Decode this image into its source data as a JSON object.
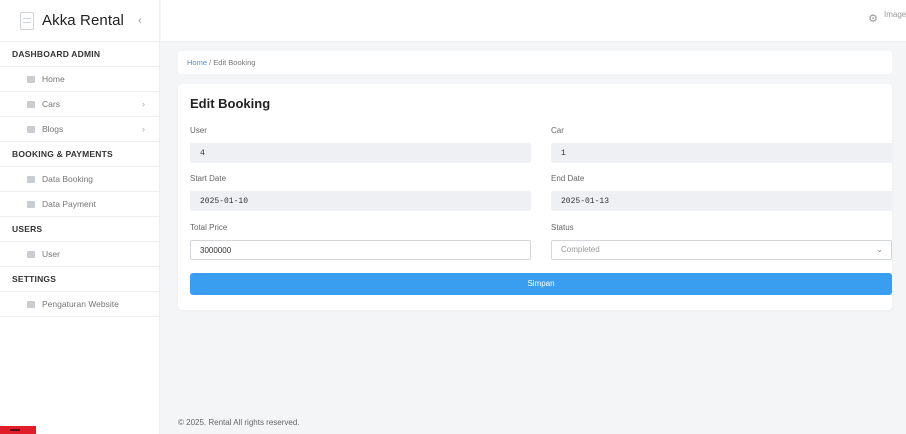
{
  "sidebar": {
    "brand": "Akka Rental",
    "toggle_icon": "chevron-left-icon",
    "toggle_glyph": "‹",
    "sections": {
      "dashboard": "DASHBOARD ADMIN",
      "booking": "BOOKING & PAYMENTS",
      "users": "USERS",
      "settings": "SETTINGS"
    },
    "items": {
      "home": "Home",
      "cars": "Cars",
      "blogs": "Blogs",
      "data_booking": "Data Booking",
      "data_payment": "Data Payment",
      "user": "User",
      "website_settings": "Pengaturan Website"
    },
    "chevron_glyph": "›"
  },
  "topbar": {
    "gear_icon": "gear-icon",
    "gear_glyph": "⚙",
    "avatar_alt": "Image"
  },
  "breadcrumb": {
    "home": "Home",
    "separator": "/",
    "current": "Edit Booking"
  },
  "form": {
    "title": "Edit Booking",
    "user_label": "User",
    "user_value": "4",
    "car_label": "Car",
    "car_value": "1",
    "start_label": "Start Date",
    "start_value": "2025-01-10",
    "end_label": "End Date",
    "end_value": "2025-01-13",
    "price_label": "Total Price",
    "price_value": "3000000",
    "status_label": "Status",
    "status_value": "Completed",
    "status_chevron": "⌄",
    "submit_label": "Simpan"
  },
  "footer": {
    "copyright": "© 2025. Rental All rights reserved."
  },
  "colors": {
    "accent": "#3a9ef0",
    "link": "#4a8fd8",
    "corner_badge": "#e11d2a"
  }
}
